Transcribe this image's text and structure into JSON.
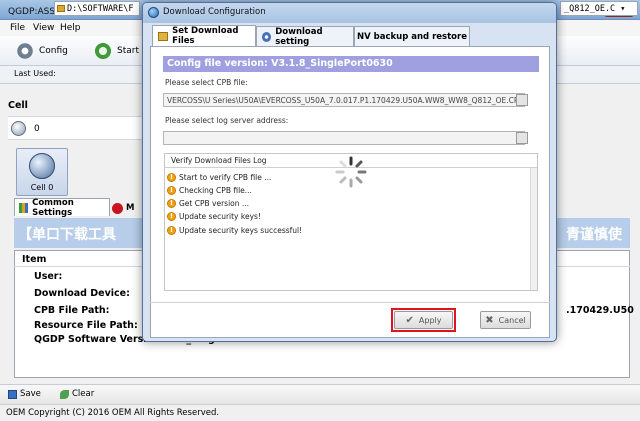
{
  "main_window": {
    "title": "QGDP:ASSEMBLY  Down的load T",
    "close_glyph": "✕",
    "menu": [
      "File",
      "View",
      "Help"
    ],
    "toolbar": {
      "config_label": "Config",
      "start_label": "Start"
    },
    "last_used": {
      "label": "Last Used:",
      "path_left": "D:\\SOFTWARE\\F",
      "path_right": "_Q812_OE.C ▾"
    },
    "cell": {
      "header": "Cell",
      "count": "0",
      "tile_label": "Cell 0"
    },
    "tabs": {
      "common": "Common Settings",
      "second": "M"
    },
    "banner": {
      "left": "【单口下载工具",
      "right": "青谨慎使"
    },
    "info": {
      "header": "Item",
      "user_label": "User:",
      "download_device_label": "Download Device:",
      "cpb_label": "CPB File Path:",
      "cpb_value": ".170429.U50",
      "resource_label": "Resource File Path:",
      "version_label": "QGDP Software Version",
      "version_value": "V3.1.8_SinglePort0630"
    },
    "footer": {
      "save_label": "Save",
      "clear_label": "Clear"
    },
    "status": "OEM Copyright (C) 2016 OEM All Rights Reserved."
  },
  "dialog": {
    "title": "Download Configuration",
    "tabs": [
      "Set Download Files",
      "Download setting",
      "NV backup and restore"
    ],
    "config_version": "Config file version: V3.1.8_SinglePort0630",
    "cpb_label": "Please select CPB file:",
    "cpb_value": "VERCOSS\\U Series\\U50A\\EVERCOSS_U50A_7.0.017.P1.170429.U50A.WW8_WW8_Q812_OE.CPB",
    "log_label": "Please select log server address:",
    "log_value": "",
    "verify_title": "Verify Download Files Log",
    "log_lines": [
      "Start to verify CPB file ...",
      "Checking CPB file...",
      "Get CPB version ...",
      "Update security keys!",
      "Update security keys successful!"
    ],
    "apply_label": "Apply",
    "cancel_label": "Cancel"
  },
  "colors": {
    "accent_highlight": "#e0141e",
    "config_bar": "#a0a0e0",
    "warning": "#f2a112"
  }
}
